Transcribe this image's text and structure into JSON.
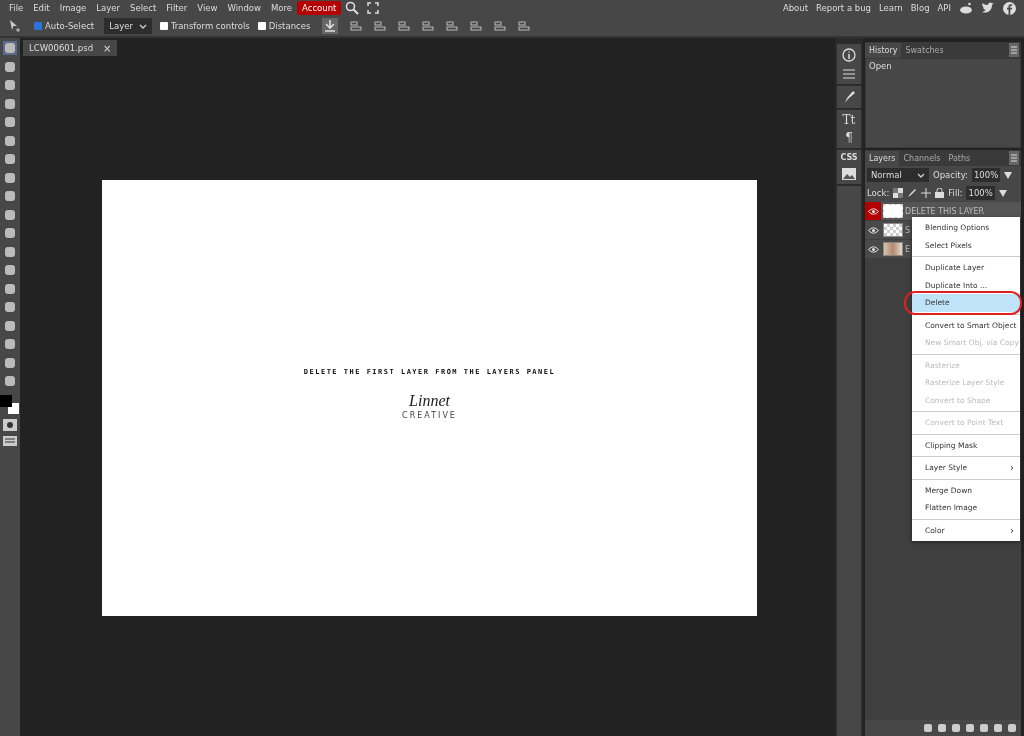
{
  "menu": [
    {
      "label": "File",
      "highlighted": false
    },
    {
      "label": "Edit",
      "highlighted": false
    },
    {
      "label": "Image",
      "highlighted": false
    },
    {
      "label": "Layer",
      "highlighted": false
    },
    {
      "label": "Select",
      "highlighted": false
    },
    {
      "label": "Filter",
      "highlighted": false
    },
    {
      "label": "View",
      "highlighted": false
    },
    {
      "label": "Window",
      "highlighted": false
    },
    {
      "label": "More",
      "highlighted": false
    },
    {
      "label": "Account",
      "highlighted": true
    }
  ],
  "links": [
    "About",
    "Report a bug",
    "Learn",
    "Blog",
    "API"
  ],
  "options": {
    "auto_select": {
      "label": "Auto-Select",
      "checked": true
    },
    "target": "Layer",
    "transform_controls": {
      "label": "Transform controls",
      "checked": false
    },
    "distances": {
      "label": "Distances",
      "checked": false
    }
  },
  "document_tab": {
    "title": "LCW00601.psd",
    "close": "×"
  },
  "canvas": {
    "instruction": "DELETE THE FIRST LAYER FROM THE LAYERS PANEL",
    "logo": "Linnet",
    "logo_sub": "CREATIVE"
  },
  "history_panel": {
    "tabs": [
      {
        "label": "History",
        "selected": true
      },
      {
        "label": "Swatches",
        "selected": false
      }
    ],
    "entries": [
      "Open"
    ]
  },
  "layers_panel": {
    "tabs": [
      {
        "label": "Layers",
        "selected": true
      },
      {
        "label": "Channels",
        "selected": false
      },
      {
        "label": "Paths",
        "selected": false
      }
    ],
    "blend_mode": "Normal",
    "opacity_label": "Opacity:",
    "opacity": "100%",
    "lock_label": "Lock:",
    "fill_label": "Fill:",
    "fill": "100%",
    "layers": [
      {
        "name": "DELETE THIS LAYER",
        "selected": true,
        "kind": "white"
      },
      {
        "name": "S",
        "selected": false,
        "kind": "transparent"
      },
      {
        "name": "E",
        "selected": false,
        "kind": "photo"
      }
    ]
  },
  "context_menu": [
    [
      {
        "label": "Blending Options",
        "disabled": false,
        "selected": false,
        "submenu": false
      },
      {
        "label": "Select Pixels",
        "disabled": false,
        "selected": false,
        "submenu": false
      }
    ],
    [
      {
        "label": "Duplicate Layer",
        "disabled": false,
        "selected": false,
        "submenu": false
      },
      {
        "label": "Duplicate Into ...",
        "disabled": false,
        "selected": false,
        "submenu": false
      },
      {
        "label": "Delete",
        "disabled": false,
        "selected": true,
        "submenu": false
      }
    ],
    [
      {
        "label": "Convert to Smart Object",
        "disabled": false,
        "selected": false,
        "submenu": false
      },
      {
        "label": "New Smart Obj. via Copy",
        "disabled": true,
        "selected": false,
        "submenu": false
      }
    ],
    [
      {
        "label": "Rasterize",
        "disabled": true,
        "selected": false,
        "submenu": false
      },
      {
        "label": "Rasterize Layer Style",
        "disabled": true,
        "selected": false,
        "submenu": false
      },
      {
        "label": "Convert to Shape",
        "disabled": true,
        "selected": false,
        "submenu": false
      }
    ],
    [
      {
        "label": "Convert to Point Text",
        "disabled": true,
        "selected": false,
        "submenu": false
      }
    ],
    [
      {
        "label": "Clipping Mask",
        "disabled": false,
        "selected": false,
        "submenu": false
      }
    ],
    [
      {
        "label": "Layer Style",
        "disabled": false,
        "selected": false,
        "submenu": true
      }
    ],
    [
      {
        "label": "Merge Down",
        "disabled": false,
        "selected": false,
        "submenu": false
      },
      {
        "label": "Flatten Image",
        "disabled": false,
        "selected": false,
        "submenu": false
      }
    ],
    [
      {
        "label": "Color",
        "disabled": false,
        "selected": false,
        "submenu": true
      }
    ]
  ],
  "submenu_arrow": "›",
  "side_icons": {
    "text_tool": "Tt",
    "paragraph": "¶",
    "css": "CSS"
  }
}
